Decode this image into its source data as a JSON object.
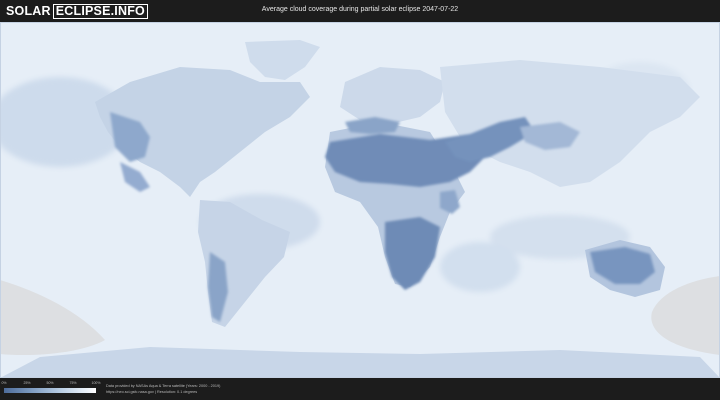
{
  "header": {
    "logo_left": "SOLAR",
    "logo_right": "ECLIPSE.INFO",
    "title": "Average cloud coverage during partial solar eclipse 2047-07-22"
  },
  "map": {
    "ocean_color": "#e9f0f8",
    "clear_land_color": "#6f8cb7",
    "cloud_color": "#ffffff",
    "eclipse_zone_color": "#d9d9d9"
  },
  "legend": {
    "ticks": [
      "0%",
      "25%",
      "50%",
      "75%",
      "100%"
    ],
    "gradient": [
      "#4e6c9a",
      "#7e9cc2",
      "#b6cbe2",
      "#e4edf7",
      "#ffffff"
    ]
  },
  "footer": {
    "credit_line1": "Data provided by NASAs Aqua & Terra satellite (Years: 2000 - 2019)",
    "credit_line2": "https://neo.sci.gsfc.nasa.gov | Resolution: 0.1 degrees"
  }
}
